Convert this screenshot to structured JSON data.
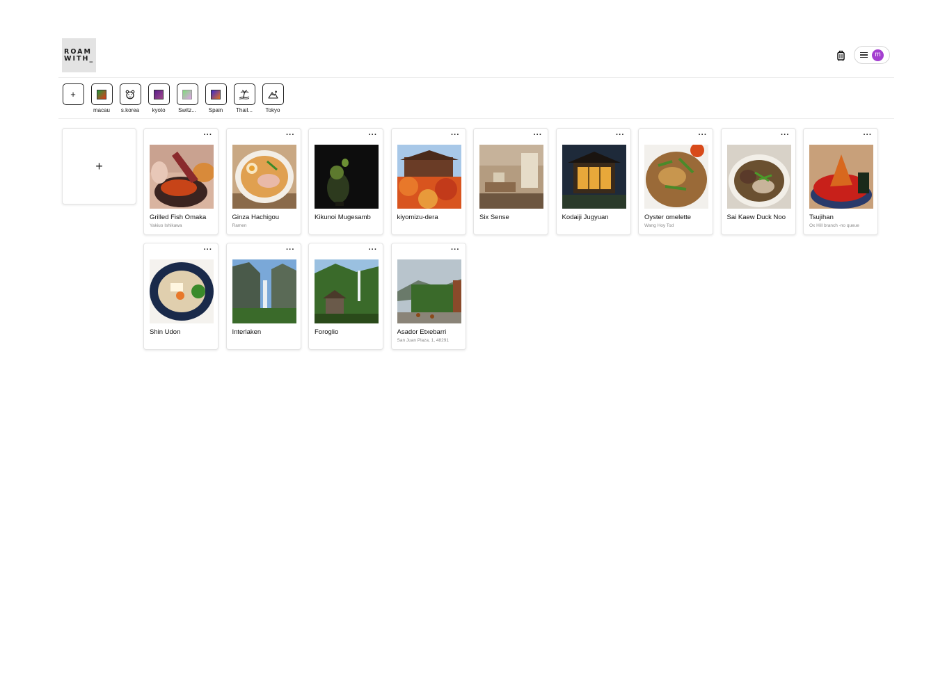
{
  "header": {
    "logo_line1": "ROAM",
    "logo_line2": "WITH_",
    "avatar_initial": "m",
    "avatar_color": "#a43fd0"
  },
  "folders": {
    "add_label": "+",
    "items": [
      {
        "label": "macau",
        "icon": "gradient-swatch",
        "colors": [
          "#1f9a3a",
          "#e03a1a"
        ]
      },
      {
        "label": "s.korea",
        "icon": "bear-face-icon"
      },
      {
        "label": "kyoto",
        "icon": "gradient-swatch",
        "colors": [
          "#5a1e8c",
          "#a04a8a"
        ]
      },
      {
        "label": "Switz...",
        "icon": "gradient-swatch",
        "colors": [
          "#7fdc7a",
          "#e0a0e8"
        ]
      },
      {
        "label": "Spain",
        "icon": "gradient-swatch",
        "colors": [
          "#3a2ad0",
          "#e07020"
        ]
      },
      {
        "label": "Thail...",
        "icon": "beach-island-icon"
      },
      {
        "label": "Tokyo",
        "icon": "mountain-icon"
      }
    ]
  },
  "add_card_label": "+",
  "cards": [
    {
      "title": "Grilled Fish Omaka",
      "subtitle": "Yakiuo Ishikawa",
      "image": "grilled-fish-photo"
    },
    {
      "title": "Ginza Hachigou",
      "subtitle": "Ramen",
      "image": "ramen-bowl-photo"
    },
    {
      "title": "Kikunoi Mugesamb",
      "subtitle": "",
      "image": "dark-dish-photo"
    },
    {
      "title": "kiyomizu-dera",
      "subtitle": "",
      "image": "temple-autumn-photo"
    },
    {
      "title": "Six Sense",
      "subtitle": "",
      "image": "hotel-room-photo"
    },
    {
      "title": "Kodaiji Jugyuan",
      "subtitle": "",
      "image": "lit-house-night-photo"
    },
    {
      "title": "Oyster omelette",
      "subtitle": "Wang Hoy Tod",
      "image": "oyster-omelette-photo"
    },
    {
      "title": "Sai Kaew Duck Noo",
      "subtitle": "",
      "image": "duck-noodle-photo"
    },
    {
      "title": "Tsujihan",
      "subtitle": "Ox Hill branch -no queue",
      "image": "seafood-bowl-photo"
    },
    {
      "title": "Shin Udon",
      "subtitle": "",
      "image": "udon-bowl-photo"
    },
    {
      "title": "Interlaken",
      "subtitle": "",
      "image": "waterfall-cliff-photo"
    },
    {
      "title": "Foroglio",
      "subtitle": "",
      "image": "village-waterfall-photo"
    },
    {
      "title": "Asador Etxebarri",
      "subtitle": "San Juan Plaza, 1, 48291",
      "image": "ivy-building-photo"
    }
  ]
}
